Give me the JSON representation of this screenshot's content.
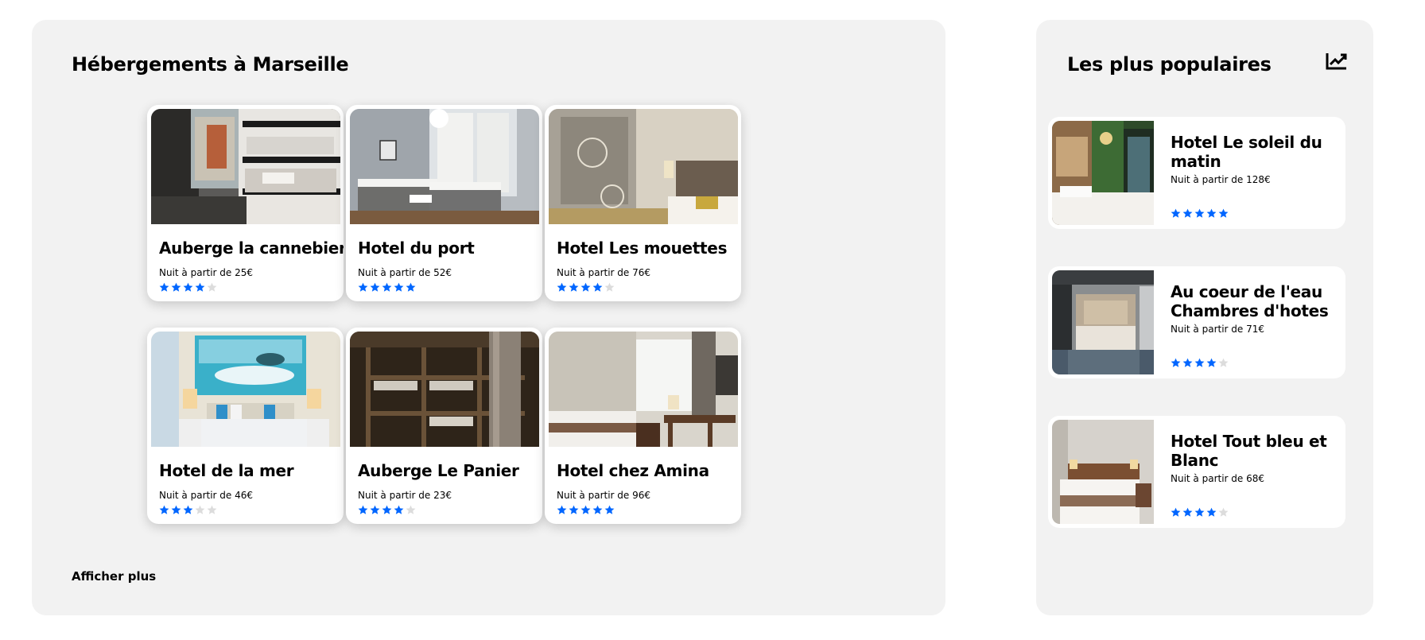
{
  "main": {
    "title": "Hébergements à Marseille",
    "more_label": "Afficher plus",
    "hotels": [
      {
        "name": "Auberge la cannebiere",
        "price_label": "Nuit à partir de 25€",
        "rating": 4,
        "photo": "bunk-bed-room-photo"
      },
      {
        "name": "Hotel du port",
        "price_label": "Nuit à partir de 52€",
        "rating": 5,
        "photo": "twin-bed-room-photo"
      },
      {
        "name": "Hotel Les mouettes",
        "price_label": "Nuit à partir de 76€",
        "rating": 4,
        "photo": "bedroom-wardrobe-photo"
      },
      {
        "name": "Hotel de la mer",
        "price_label": "Nuit à partir de 46€",
        "rating": 3,
        "photo": "sea-painting-room-photo"
      },
      {
        "name": "Auberge Le Panier",
        "price_label": "Nuit à partir de 23€",
        "rating": 4,
        "photo": "wooden-bunks-photo"
      },
      {
        "name": "Hotel chez Amina",
        "price_label": "Nuit à partir de 96€",
        "rating": 5,
        "photo": "bright-room-desk-photo"
      }
    ]
  },
  "sidebar": {
    "title": "Les plus populaires",
    "icon": "trending-up-icon",
    "hotels": [
      {
        "name": "Hotel Le soleil du matin",
        "price_label": "Nuit à partir de 128€",
        "rating": 5,
        "photo": "green-room-photo"
      },
      {
        "name": "Au coeur de l'eau Chambres d'hotes",
        "price_label": "Nuit à partir de 71€",
        "rating": 4,
        "photo": "tufted-bed-room-photo"
      },
      {
        "name": "Hotel Tout bleu et Blanc",
        "price_label": "Nuit à partir de 68€",
        "rating": 4,
        "photo": "wood-headboard-room-photo"
      }
    ]
  },
  "colors": {
    "panel_bg": "#f2f2f2",
    "star_active": "#0066ff",
    "star_inactive": "#dcdcdc",
    "text": "#000000"
  }
}
